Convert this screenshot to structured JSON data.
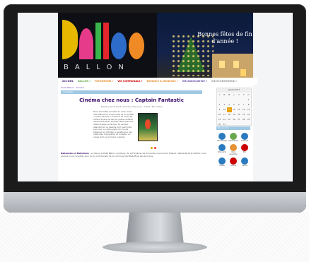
{
  "site": {
    "logo_text": "BALLON",
    "greeting": "Bonnes fêtes de fin d'année !"
  },
  "menu": [
    {
      "label": "ACCUEIL",
      "color": "#4b2a7a"
    },
    {
      "label": "BALLON ▾",
      "color": "#6aa84f"
    },
    {
      "label": "PATRIMOINE ▾",
      "color": "#e69138"
    },
    {
      "label": "VIE COMMUNALE ▾",
      "color": "#cc0000"
    },
    {
      "label": "ENFANCE & JEUNESSE ▾",
      "color": "#e69138"
    },
    {
      "label": "VIE ASSOCIATIVE ▾",
      "color": "#674ea7"
    },
    {
      "label": "VIE ÉCONOMIQUE ▾",
      "color": "#999999"
    }
  ],
  "breadcrumb": "Vous êtes ici : Accueil",
  "section_label": "Actualités",
  "article": {
    "title": "Cinéma chez nous : Captain Fantastic",
    "meta": "Publié le jeudi 15/12, dernière mise à jour : 16/12 - Par mairie",
    "body": "Dans les forêts reculées du nord-ouest des États-Unis, vivant isolé de la société, un père dévoué a consacré sa vie toute entière à faire de ses six jeunes enfants d'extraordinaires adultes. Mais quand le destin frappe sa famille, ils doivent abandonner ce paradis qu'il avait créé pour eux. La découverte du monde extérieur va l'obliger à questionner ses méthodes d'éducation et remettre en cause tout ce qu'il leur a appris."
  },
  "footer": {
    "strong": "Ballonnais en Balloniens",
    "text": " : La Sauve le Petit Ballon, Le Bourg, de la Fontaine, de la Grande rue et de la Tuilerie, habitants de la Sarthe, vous pouvez nous consulter pour la vie communale de la commune de BALLON et ses environs."
  },
  "calendar": {
    "title": "Janvier 2017",
    "headers": [
      "L",
      "M",
      "M",
      "J",
      "V",
      "S",
      "D"
    ],
    "rows": [
      [
        "",
        "",
        "",
        "",
        "",
        "",
        "1"
      ],
      [
        "2",
        "3",
        "4",
        "5",
        "6",
        "7",
        "8"
      ],
      [
        "9",
        "10",
        "11",
        "12",
        "13",
        "14",
        "15"
      ],
      [
        "16",
        "17",
        "18",
        "19",
        "20",
        "21",
        "22"
      ],
      [
        "23",
        "24",
        "25",
        "26",
        "27",
        "28",
        "29"
      ],
      [
        "30",
        "31",
        "",
        "",
        "",
        "",
        ""
      ]
    ],
    "today": "11"
  },
  "sidebar": {
    "head": "En un clic",
    "icons": [
      {
        "label": "Ramassage",
        "color": "#2a7abf",
        "icon": "document-icon"
      },
      {
        "label": "Informations",
        "color": "#6aa84f",
        "icon": "info-icon"
      },
      {
        "label": "Contacts",
        "color": "#2a7abf",
        "icon": "phone-icon"
      },
      {
        "label": "Urbanisme",
        "color": "#2a7abf",
        "icon": "map-icon"
      },
      {
        "label": "Vivre ensemble",
        "color": "#e69138",
        "icon": "people-icon"
      },
      {
        "label": "PLU",
        "color": "#cc0000",
        "icon": "plu-icon"
      },
      {
        "label": "Écoles",
        "color": "#2a7abf",
        "icon": "school-icon"
      },
      {
        "label": "Culture",
        "color": "#cc0000",
        "icon": "culture-icon"
      },
      {
        "label": "Sports",
        "color": "#2a7abf",
        "icon": "sport-icon"
      }
    ]
  }
}
